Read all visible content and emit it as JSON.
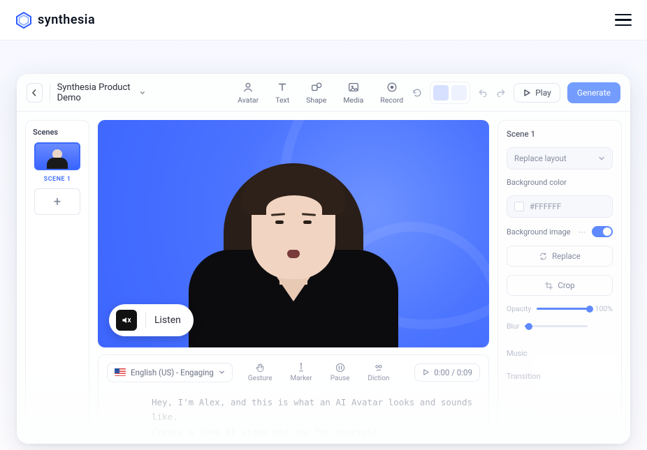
{
  "brand": {
    "name": "synthesia"
  },
  "toolbar": {
    "project_title": "Synthesia Product Demo",
    "tools": {
      "avatar": "Avatar",
      "text": "Text",
      "shape": "Shape",
      "media": "Media",
      "record": "Record"
    },
    "play_label": "Play",
    "generate_label": "Generate"
  },
  "scenes": {
    "title": "Scenes",
    "scene1_label": "SCENE 1"
  },
  "listen": {
    "label": "Listen"
  },
  "scriptbar": {
    "language_label": "English (US) - Engaging",
    "tools": {
      "gesture": "Gesture",
      "marker": "Marker",
      "pause": "Pause",
      "diction": "Diction"
    },
    "time": "0:00 / 0:09",
    "script_line1": "Hey, I'm Alex, and this is what an AI Avatar looks and sounds like.",
    "script_line2": "Create a free AI video and see for yourself."
  },
  "rpanel": {
    "scene_title": "Scene 1",
    "replace_layout": "Replace layout",
    "bg_color_label": "Background color",
    "bg_color_value": "#FFFFFF",
    "bg_image_label": "Background image",
    "replace_btn": "Replace",
    "crop_btn": "Crop",
    "opacity_label": "Opacity",
    "opacity_value": "100%",
    "blur_label": "Blur",
    "music_label": "Music",
    "transition_label": "Transition"
  },
  "colors": {
    "accent": "#4f7dff"
  }
}
